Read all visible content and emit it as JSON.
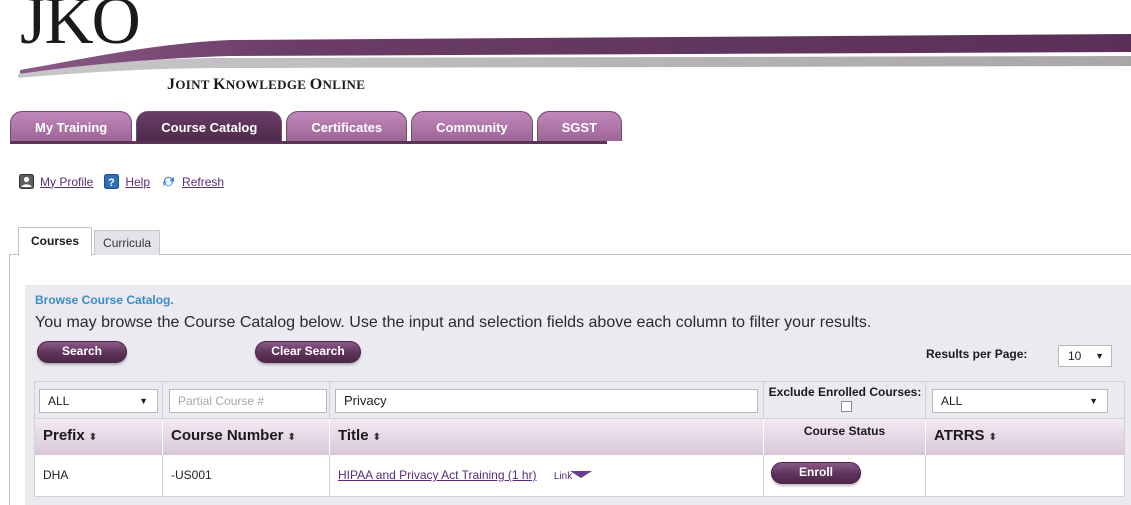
{
  "brand": {
    "logo_mark": "JKO",
    "logo_subtitle_first": "J",
    "logo_subtitle_rest": "OINT ",
    "logo_subtitle_k": "K",
    "logo_subtitle_mid": "NOWLEDGE ",
    "logo_subtitle_o": "O",
    "logo_subtitle_end": "NLINE",
    "colors": {
      "accent": "#5e325a",
      "link": "#5a2c78",
      "title_blue": "#3a8dc4"
    }
  },
  "main_tabs": [
    {
      "label": "My Training",
      "active": false
    },
    {
      "label": "Course Catalog",
      "active": true
    },
    {
      "label": "Certificates",
      "active": false
    },
    {
      "label": "Community",
      "active": false
    },
    {
      "label": "SGST",
      "active": false
    }
  ],
  "utility_links": [
    {
      "label": "My Profile",
      "icon": "profile-icon"
    },
    {
      "label": "Help",
      "icon": "help-icon"
    },
    {
      "label": "Refresh",
      "icon": "refresh-icon"
    }
  ],
  "sub_tabs": [
    {
      "label": "Courses",
      "active": true
    },
    {
      "label": "Curricula",
      "active": false
    }
  ],
  "browse": {
    "title": "Browse Course Catalog.",
    "description": "You may browse the Course Catalog below. Use the input and selection fields above each column to filter your results.",
    "search_label": "Search",
    "clear_label": "Clear Search",
    "results_per_page_label": "Results per Page:",
    "results_per_page_value": "10"
  },
  "filters": {
    "prefix_value": "ALL",
    "course_number_placeholder": "Partial Course #",
    "title_value": "Privacy",
    "exclude_enrolled_label": "Exclude Enrolled Courses:",
    "exclude_enrolled_checked": false,
    "atrrs_value": "ALL"
  },
  "columns": {
    "prefix": "Prefix",
    "course_number": "Course Number",
    "title": "Title",
    "status": "Course Status",
    "atrrs": "ATRRS",
    "sort_glyph": "⬍"
  },
  "rows": [
    {
      "prefix": "DHA",
      "course_number": "-US001",
      "title": "HIPAA and Privacy Act Training (1 hr)",
      "link_label": "Link",
      "action_label": "Enroll",
      "atrrs": ""
    }
  ]
}
